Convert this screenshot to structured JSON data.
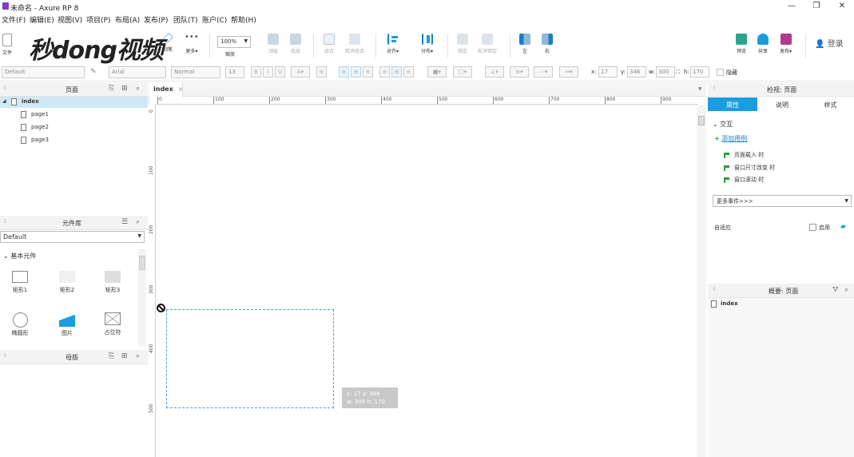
{
  "window": {
    "title": "未命名 - Axure RP 8"
  },
  "menu": [
    "文件(F)",
    "编辑(E)",
    "视图(V)",
    "项目(P)",
    "布局(A)",
    "发布(P)",
    "团队(T)",
    "账户(C)",
    "帮助(H)"
  ],
  "toolbar": {
    "file_label": "文件",
    "pen_label": "钢笔",
    "more_label": "更多▾",
    "zoom_value": "100%",
    "zoom_label": "缩放",
    "top_label": "顶层",
    "bottom_label": "底层",
    "group_label": "组合",
    "ungroup_label": "取消组合",
    "align_label": "对齐▾",
    "distribute_label": "分布▾",
    "lock_label": "锁定",
    "unlock_label": "取消锁定",
    "left_label": "左",
    "right_label": "右",
    "preview_label": "预览",
    "share_label": "共享",
    "publish_label": "发布▾",
    "login_label": "登录",
    "watermark": "秒dong视频"
  },
  "formatbar": {
    "style": "Default",
    "font": "Arial",
    "weight": "Normal",
    "size": "13",
    "x_label": "x:",
    "x_value": "17",
    "y_label": "y:",
    "y_value": "346",
    "w_label": "w:",
    "w_value": "300",
    "h_label": "h:",
    "h_value": "170",
    "hidden_label": "隐藏"
  },
  "pages_panel": {
    "title": "页面",
    "items": [
      "index",
      "page1",
      "page2",
      "page3"
    ]
  },
  "library_panel": {
    "title": "元件库",
    "selected": "Default",
    "section": "基本元件",
    "widgets": [
      "矩形1",
      "矩形2",
      "矩形3",
      "椭圆形",
      "图片",
      "占位符"
    ]
  },
  "masters_panel": {
    "title": "母版"
  },
  "canvas": {
    "tab": "index",
    "ruler_h": [
      "0",
      "100",
      "200",
      "300",
      "400",
      "500",
      "600",
      "700",
      "800",
      "900"
    ],
    "ruler_v": [
      "0",
      "100",
      "200",
      "300",
      "400",
      "500"
    ],
    "tooltip_line1": "x: 17     y: 346",
    "tooltip_line2": "w: 300   h: 170"
  },
  "inspector": {
    "title": "检视: 页面",
    "tabs": [
      "属性",
      "说明",
      "样式"
    ],
    "section": "交互",
    "add_case": "添加用例",
    "events": [
      "页面载入 时",
      "窗口尺寸改变 时",
      "窗口滚动 时"
    ],
    "more_events": "更多事件>>>",
    "adaptive_label": "自适应",
    "enable_label": "启用"
  },
  "outline": {
    "title": "概要: 页面",
    "item": "index"
  },
  "colors": {
    "accent": "#1c9ce0",
    "selection": "#cfe8f6",
    "event_flag": "#2e9b3e"
  }
}
